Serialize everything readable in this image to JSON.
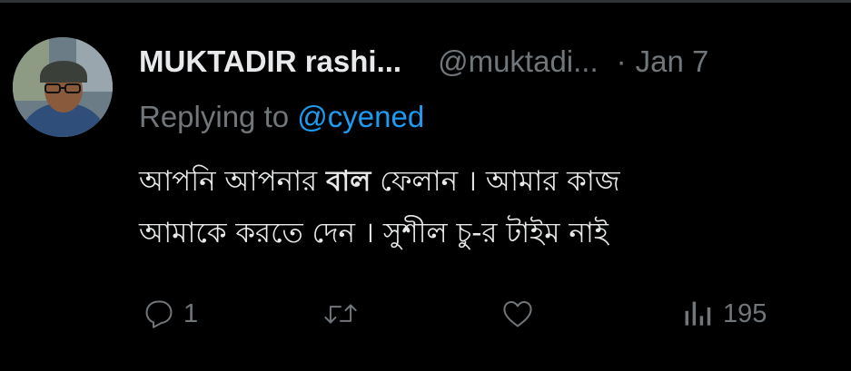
{
  "tweet": {
    "display_name": "MUKTADIR rashi...",
    "handle": "@muktadi...",
    "separator": "·",
    "date": "Jan 7",
    "replying_prefix": "Replying to",
    "replying_to": "@cyened",
    "text_line1_a": "আপনি আপনার",
    "text_line1_bold": "বাল",
    "text_line1_b": "ফেলান । আমার কাজ",
    "text_line2": "আমাকে করতে দেন । সুশীল চু-র টাইম নাই"
  },
  "actions": {
    "reply_icon": "reply-icon",
    "reply_count": "1",
    "retweet_icon": "retweet-icon",
    "like_icon": "heart-icon",
    "views_icon": "views-icon",
    "views_count": "195"
  },
  "colors": {
    "background": "#000000",
    "text": "#e7e9ea",
    "muted": "#71767b",
    "link": "#1d9bf0"
  }
}
